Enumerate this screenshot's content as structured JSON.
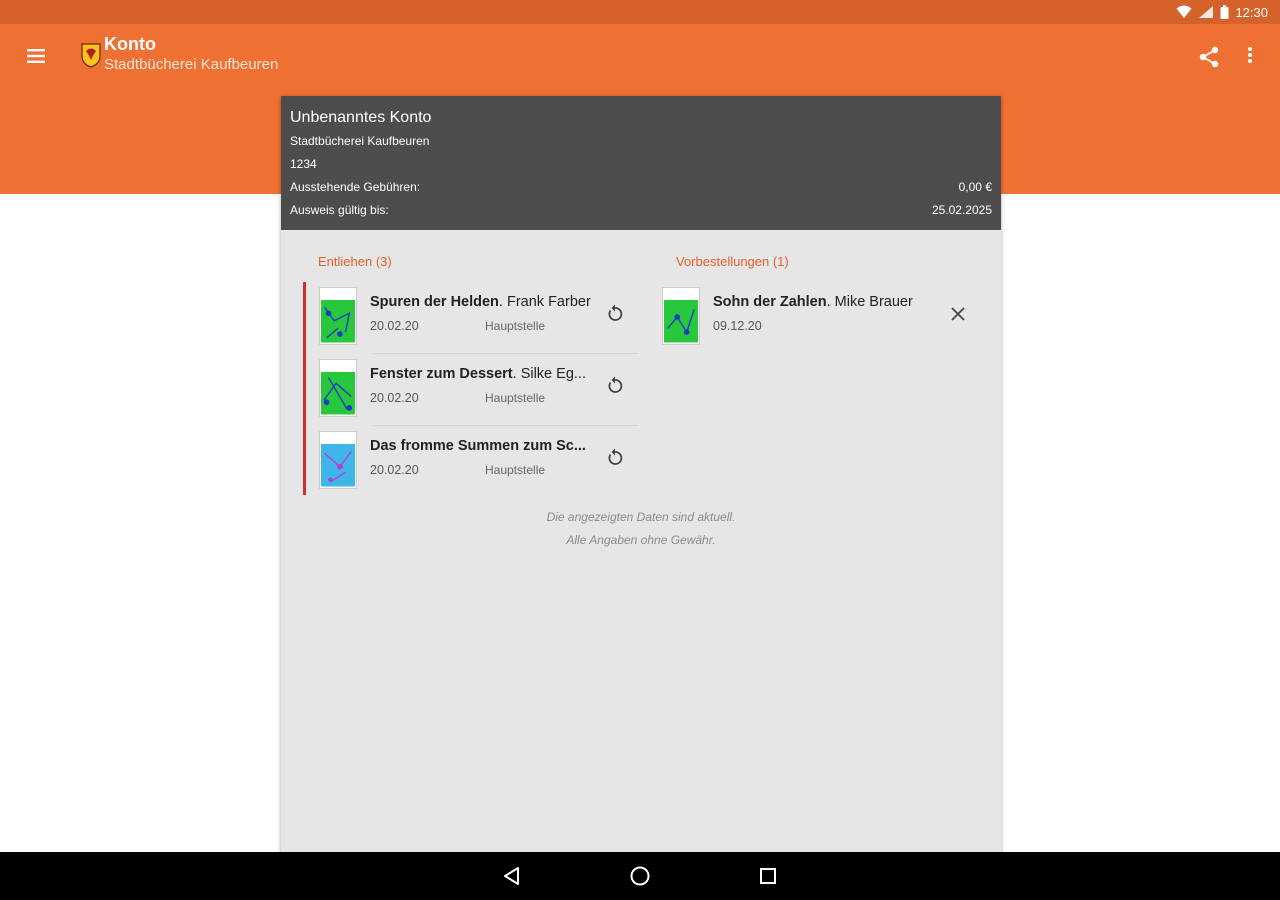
{
  "status": {
    "time": "12:30"
  },
  "appbar": {
    "title": "Konto",
    "subtitle": "Stadtbücherei Kaufbeuren"
  },
  "account": {
    "name": "Unbenanntes Konto",
    "library": "Stadtbücherei Kaufbeuren",
    "number": "1234",
    "fees_label": "Ausstehende Gebühren:",
    "fees_value": "0,00 €",
    "valid_label": "Ausweis gültig bis:",
    "valid_value": "25.02.2025"
  },
  "lent": {
    "title": "Entliehen (3)",
    "items": [
      {
        "title": "Spuren der Helden",
        "author": ". Frank Farber",
        "date": "20.02.20",
        "branch": "Hauptstelle",
        "action_icon": "renew-icon"
      },
      {
        "title": "Fenster zum Dessert",
        "author": ". Silke Eg...",
        "date": "20.02.20",
        "branch": "Hauptstelle",
        "action_icon": "renew-icon"
      },
      {
        "title": "Das fromme Summen zum Sc...",
        "author": "",
        "date": "20.02.20",
        "branch": "Hauptstelle",
        "action_icon": "renew-icon"
      }
    ]
  },
  "reservations": {
    "title": "Vorbestellungen (1)",
    "items": [
      {
        "title": "Sohn der Zahlen",
        "author": ". Mike Brauer",
        "date": "09.12.20",
        "action_icon": "close-icon"
      }
    ]
  },
  "note": {
    "line1": "Die angezeigten Daten sind aktuell.",
    "line2": "Alle Angaben ohne Gewähr."
  },
  "colors": {
    "primary": "#ee7033",
    "status": "#d4622a",
    "accent": "#e8602a",
    "header": "#4d4d4d",
    "overdue": "#d32f2f"
  }
}
